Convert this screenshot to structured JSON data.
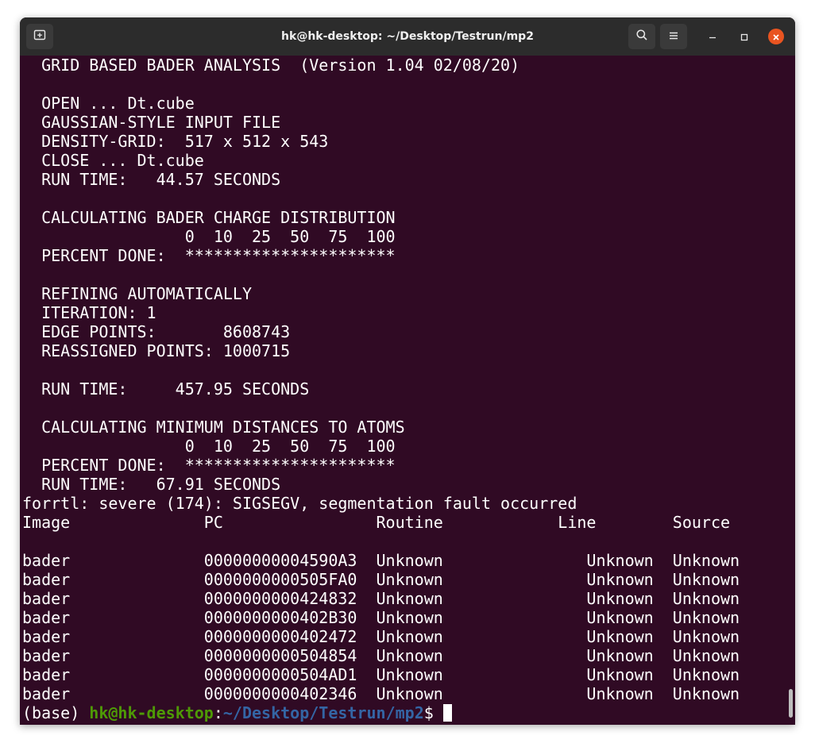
{
  "window": {
    "title": "hk@hk-desktop: ~/Desktop/Testrun/mp2"
  },
  "toolbar": {
    "new_tab_icon": "new-tab-icon",
    "search_icon": "search-icon",
    "menu_icon": "hamburger-menu-icon",
    "minimize_icon": "minimize-icon",
    "maximize_icon": "maximize-icon",
    "close_icon": "close-icon"
  },
  "colors": {
    "terminal_bg": "#300a24",
    "titlebar_bg": "#2c2c2c",
    "prompt_user": "#4e9a06",
    "prompt_path": "#3465a4",
    "close_button": "#e95420"
  },
  "terminal": {
    "lines": [
      "  GRID BASED BADER ANALYSIS  (Version 1.04 02/08/20)",
      "",
      "  OPEN ... Dt.cube",
      "  GAUSSIAN-STYLE INPUT FILE",
      "  DENSITY-GRID:  517 x 512 x 543",
      "  CLOSE ... Dt.cube",
      "  RUN TIME:   44.57 SECONDS",
      "",
      "  CALCULATING BADER CHARGE DISTRIBUTION",
      "                 0  10  25  50  75  100",
      "  PERCENT DONE:  **********************",
      "",
      "  REFINING AUTOMATICALLY",
      "  ITERATION: 1",
      "  EDGE POINTS:       8608743",
      "  REASSIGNED POINTS: 1000715",
      "",
      "  RUN TIME:     457.95 SECONDS",
      "",
      "  CALCULATING MINIMUM DISTANCES TO ATOMS",
      "                 0  10  25  50  75  100",
      "  PERCENT DONE:  **********************",
      "  RUN TIME:   67.91 SECONDS",
      "forrtl: severe (174): SIGSEGV, segmentation fault occurred",
      "Image              PC                Routine            Line        Source",
      "",
      "bader              00000000004590A3  Unknown               Unknown  Unknown",
      "bader              0000000000505FA0  Unknown               Unknown  Unknown",
      "bader              0000000000424832  Unknown               Unknown  Unknown",
      "bader              0000000000402B30  Unknown               Unknown  Unknown",
      "bader              0000000000402472  Unknown               Unknown  Unknown",
      "bader              0000000000504854  Unknown               Unknown  Unknown",
      "bader              0000000000504AD1  Unknown               Unknown  Unknown",
      "bader              0000000000402346  Unknown               Unknown  Unknown"
    ],
    "prompt": {
      "env": "(base) ",
      "user_host": "hk@hk-desktop",
      "separator": ":",
      "path": "~/Desktop/Testrun/mp2",
      "symbol": "$ "
    }
  }
}
